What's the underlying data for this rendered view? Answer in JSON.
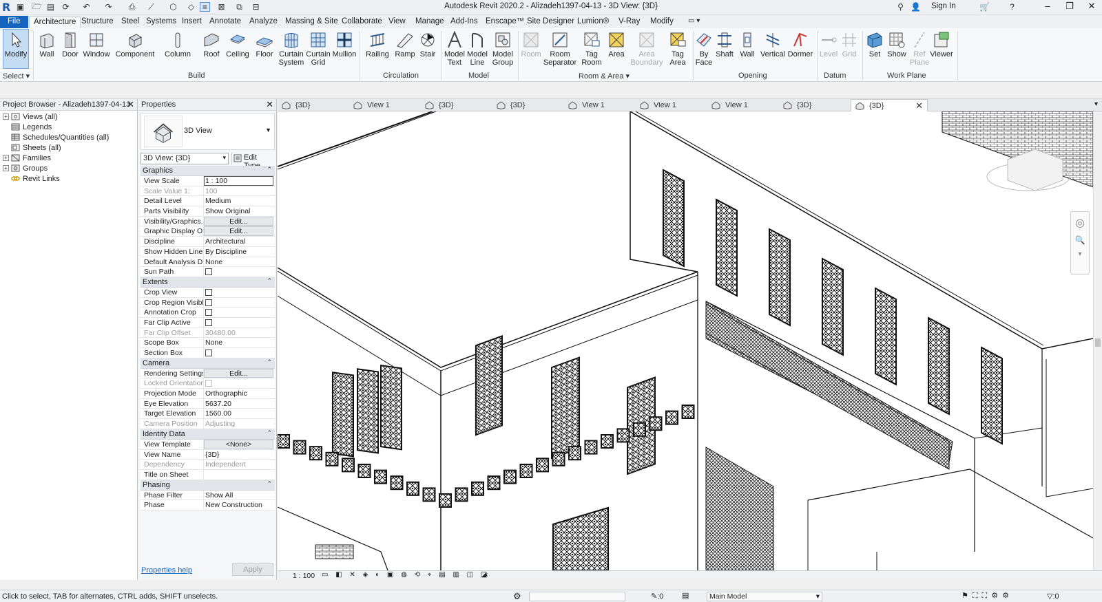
{
  "window": {
    "title": "Autodesk Revit 2020.2 - Alizadeh1397-04-13 - 3D View: {3D}",
    "sign_in": "Sign In",
    "logo": "R"
  },
  "menu": {
    "tabs": [
      "File",
      "Architecture",
      "Structure",
      "Steel",
      "Systems",
      "Insert",
      "Annotate",
      "Analyze",
      "Massing & Site",
      "Collaborate",
      "View",
      "Manage",
      "Add-Ins",
      "Enscape™",
      "Site Designer",
      "Lumion®",
      "V-Ray",
      "Modify"
    ],
    "active": "Architecture"
  },
  "ribbon": {
    "select": {
      "modify": "Modify",
      "panel": "Select"
    },
    "build": {
      "panel": "Build",
      "buttons": [
        "Wall",
        "Door",
        "Window",
        "Component",
        "Column",
        "Roof",
        "Ceiling",
        "Floor",
        "Curtain\nSystem",
        "Curtain\nGrid",
        "Mullion"
      ]
    },
    "circulation": {
      "panel": "Circulation",
      "buttons": [
        "Railing",
        "Ramp",
        "Stair"
      ]
    },
    "model": {
      "panel": "Model",
      "buttons": [
        "Model\nText",
        "Model\nLine",
        "Model\nGroup"
      ]
    },
    "room_area": {
      "panel": "Room & Area",
      "buttons": [
        "Room",
        "Room\nSeparator",
        "Tag\nRoom",
        "Area",
        "Area\nBoundary",
        "Tag\nArea"
      ]
    },
    "opening": {
      "panel": "Opening",
      "buttons": [
        "By\nFace",
        "Shaft",
        "Wall",
        "Vertical",
        "Dormer"
      ]
    },
    "datum": {
      "panel": "Datum",
      "buttons": [
        "Level",
        "Grid"
      ]
    },
    "work_plane": {
      "panel": "Work Plane",
      "buttons": [
        "Set",
        "Show",
        "Ref\nPlane",
        "Viewer"
      ]
    }
  },
  "project_browser": {
    "title": "Project Browser - Alizadeh1397-04-13",
    "items": [
      "Views (all)",
      "Legends",
      "Schedules/Quantities (all)",
      "Sheets (all)",
      "Families",
      "Groups",
      "Revit Links"
    ]
  },
  "properties": {
    "title": "Properties",
    "type_name": "3D View",
    "view_selector": "3D View: {3D}",
    "edit_type": "Edit Type",
    "sections": [
      {
        "name": "Graphics",
        "rows": [
          {
            "name": "View Scale",
            "value": "1 : 100",
            "kind": "input"
          },
          {
            "name": "Scale Value    1:",
            "value": "100",
            "kind": "disabled"
          },
          {
            "name": "Detail Level",
            "value": "Medium"
          },
          {
            "name": "Parts Visibility",
            "value": "Show Original"
          },
          {
            "name": "Visibility/Graphics...",
            "value": "Edit...",
            "kind": "button"
          },
          {
            "name": "Graphic Display O...",
            "value": "Edit...",
            "kind": "button"
          },
          {
            "name": "Discipline",
            "value": "Architectural"
          },
          {
            "name": "Show Hidden Lines",
            "value": "By Discipline"
          },
          {
            "name": "Default Analysis D...",
            "value": "None"
          },
          {
            "name": "Sun Path",
            "value": "",
            "kind": "checkbox"
          }
        ]
      },
      {
        "name": "Extents",
        "rows": [
          {
            "name": "Crop View",
            "value": "",
            "kind": "checkbox"
          },
          {
            "name": "Crop Region Visible",
            "value": "",
            "kind": "checkbox"
          },
          {
            "name": "Annotation Crop",
            "value": "",
            "kind": "checkbox"
          },
          {
            "name": "Far Clip Active",
            "value": "",
            "kind": "checkbox"
          },
          {
            "name": "Far Clip Offset",
            "value": "30480.00",
            "kind": "disabled"
          },
          {
            "name": "Scope Box",
            "value": "None"
          },
          {
            "name": "Section Box",
            "value": "",
            "kind": "checkbox"
          }
        ]
      },
      {
        "name": "Camera",
        "rows": [
          {
            "name": "Rendering Settings",
            "value": "Edit...",
            "kind": "button"
          },
          {
            "name": "Locked Orientation",
            "value": "",
            "kind": "disabled-checkbox"
          },
          {
            "name": "Projection Mode",
            "value": "Orthographic"
          },
          {
            "name": "Eye Elevation",
            "value": "5637.20"
          },
          {
            "name": "Target Elevation",
            "value": "1560.00"
          },
          {
            "name": "Camera Position",
            "value": "Adjusting",
            "kind": "disabled"
          }
        ]
      },
      {
        "name": "Identity Data",
        "rows": [
          {
            "name": "View Template",
            "value": "<None>",
            "kind": "button"
          },
          {
            "name": "View Name",
            "value": "{3D}"
          },
          {
            "name": "Dependency",
            "value": "Independent",
            "kind": "disabled"
          },
          {
            "name": "Title on Sheet",
            "value": ""
          }
        ]
      },
      {
        "name": "Phasing",
        "rows": [
          {
            "name": "Phase Filter",
            "value": "Show All"
          },
          {
            "name": "Phase",
            "value": "New Construction"
          }
        ]
      }
    ],
    "help_link": "Properties help",
    "apply": "Apply"
  },
  "view_tabs": [
    "{3D}",
    "View 1",
    "{3D}",
    "{3D}",
    "View 1",
    "View 1",
    "View 1",
    "{3D}",
    "{3D}"
  ],
  "view_control_bar": {
    "scale": "1 : 100"
  },
  "status_bar": {
    "text": "Click to select, TAB for alternates, CTRL adds, SHIFT unselects.",
    "worksets": ":0",
    "model": "Main Model",
    "filter": ":0"
  }
}
